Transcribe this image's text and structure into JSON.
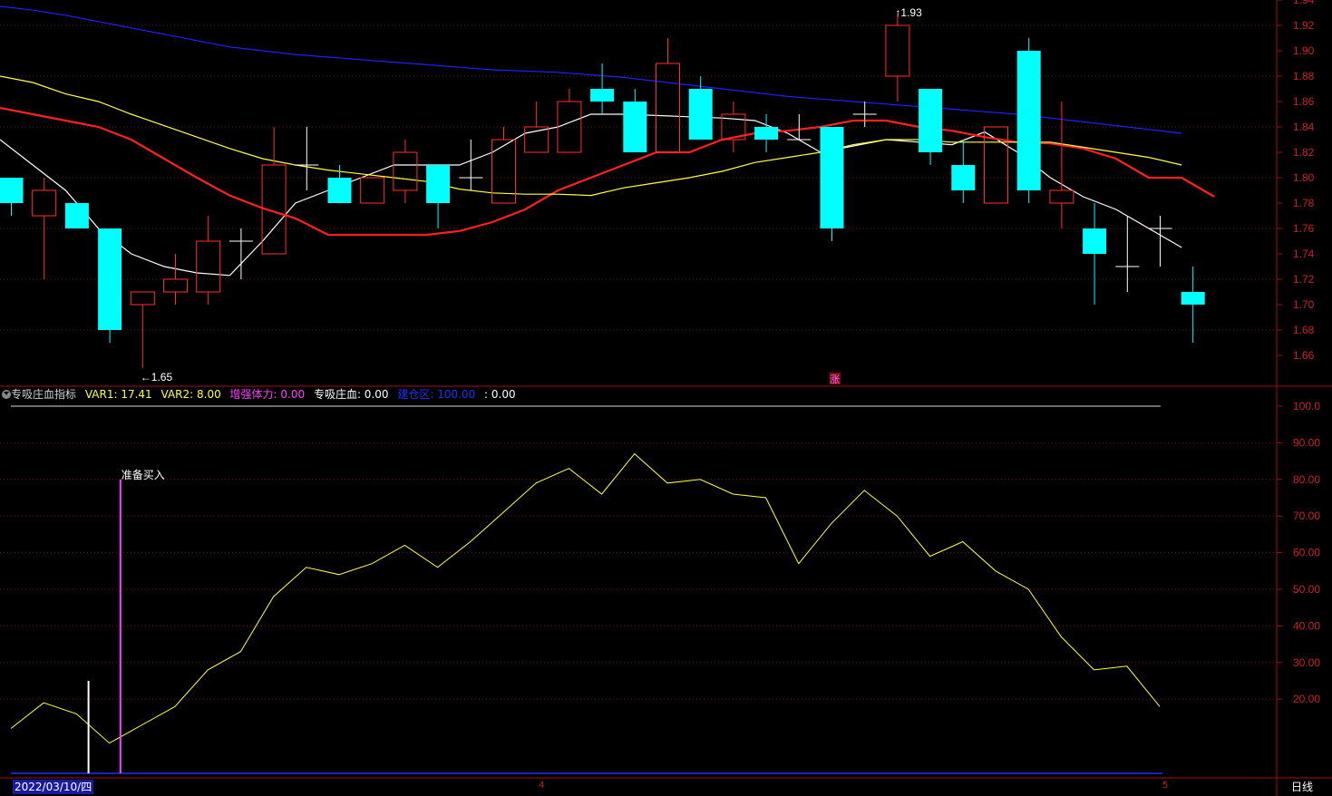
{
  "chart_data": [
    {
      "type": "candlestick",
      "panel": "main",
      "ylim": [
        1.64,
        1.94
      ],
      "y_ticks": [
        "1.94",
        "1.92",
        "1.90",
        "1.88",
        "1.86",
        "1.84",
        "1.82",
        "1.80",
        "1.78",
        "1.76",
        "1.74",
        "1.72",
        "1.70",
        "1.68",
        "1.66"
      ],
      "candles": [
        {
          "o": 1.8,
          "h": 1.8,
          "l": 1.77,
          "c": 1.78
        },
        {
          "o": 1.77,
          "h": 1.8,
          "l": 1.72,
          "c": 1.79
        },
        {
          "o": 1.78,
          "h": 1.78,
          "l": 1.76,
          "c": 1.76
        },
        {
          "o": 1.76,
          "h": 1.76,
          "l": 1.67,
          "c": 1.68
        },
        {
          "o": 1.7,
          "h": 1.71,
          "l": 1.65,
          "c": 1.71
        },
        {
          "o": 1.71,
          "h": 1.74,
          "l": 1.7,
          "c": 1.72
        },
        {
          "o": 1.71,
          "h": 1.77,
          "l": 1.7,
          "c": 1.75
        },
        {
          "o": 1.75,
          "h": 1.76,
          "l": 1.72,
          "c": 1.75
        },
        {
          "o": 1.74,
          "h": 1.84,
          "l": 1.74,
          "c": 1.81
        },
        {
          "o": 1.81,
          "h": 1.84,
          "l": 1.79,
          "c": 1.81
        },
        {
          "o": 1.8,
          "h": 1.81,
          "l": 1.78,
          "c": 1.78
        },
        {
          "o": 1.78,
          "h": 1.8,
          "l": 1.78,
          "c": 1.8
        },
        {
          "o": 1.79,
          "h": 1.83,
          "l": 1.78,
          "c": 1.82
        },
        {
          "o": 1.81,
          "h": 1.81,
          "l": 1.76,
          "c": 1.78
        },
        {
          "o": 1.8,
          "h": 1.83,
          "l": 1.79,
          "c": 1.8
        },
        {
          "o": 1.78,
          "h": 1.84,
          "l": 1.78,
          "c": 1.83
        },
        {
          "o": 1.82,
          "h": 1.86,
          "l": 1.82,
          "c": 1.84
        },
        {
          "o": 1.82,
          "h": 1.87,
          "l": 1.82,
          "c": 1.86
        },
        {
          "o": 1.87,
          "h": 1.89,
          "l": 1.85,
          "c": 1.86
        },
        {
          "o": 1.86,
          "h": 1.87,
          "l": 1.82,
          "c": 1.82
        },
        {
          "o": 1.82,
          "h": 1.91,
          "l": 1.82,
          "c": 1.89
        },
        {
          "o": 1.87,
          "h": 1.88,
          "l": 1.83,
          "c": 1.83
        },
        {
          "o": 1.83,
          "h": 1.86,
          "l": 1.82,
          "c": 1.85
        },
        {
          "o": 1.84,
          "h": 1.85,
          "l": 1.82,
          "c": 1.83
        },
        {
          "o": 1.83,
          "h": 1.85,
          "l": 1.83,
          "c": 1.83
        },
        {
          "o": 1.84,
          "h": 1.84,
          "l": 1.75,
          "c": 1.76
        },
        {
          "o": 1.85,
          "h": 1.86,
          "l": 1.84,
          "c": 1.85
        },
        {
          "o": 1.88,
          "h": 1.93,
          "l": 1.86,
          "c": 1.92
        },
        {
          "o": 1.87,
          "h": 1.87,
          "l": 1.81,
          "c": 1.82
        },
        {
          "o": 1.81,
          "h": 1.83,
          "l": 1.78,
          "c": 1.79
        },
        {
          "o": 1.78,
          "h": 1.84,
          "l": 1.78,
          "c": 1.84
        },
        {
          "o": 1.9,
          "h": 1.91,
          "l": 1.78,
          "c": 1.79
        },
        {
          "o": 1.78,
          "h": 1.86,
          "l": 1.76,
          "c": 1.79
        },
        {
          "o": 1.76,
          "h": 1.78,
          "l": 1.7,
          "c": 1.74
        },
        {
          "o": 1.73,
          "h": 1.77,
          "l": 1.71,
          "c": 1.73
        },
        {
          "o": 1.76,
          "h": 1.77,
          "l": 1.73,
          "c": 1.76
        },
        {
          "o": 1.71,
          "h": 1.73,
          "l": 1.67,
          "c": 1.7
        }
      ],
      "series": [
        {
          "color": "#ffffff",
          "values": [
            1.83,
            1.81,
            1.79,
            1.76,
            1.74,
            1.73,
            1.725,
            1.723,
            1.75,
            1.78,
            1.79,
            1.8,
            1.81,
            1.81,
            1.81,
            1.82,
            1.835,
            1.84,
            1.85,
            1.85,
            1.849,
            1.848,
            1.847,
            1.845,
            1.835,
            1.82,
            1.825,
            1.83,
            1.828,
            1.826,
            1.836,
            1.82,
            1.8,
            1.785,
            1.775,
            1.76,
            1.745
          ]
        },
        {
          "color": "#ff2020",
          "values": [
            1.855,
            1.85,
            1.845,
            1.84,
            1.83,
            1.815,
            1.8,
            1.786,
            1.776,
            1.768,
            1.755,
            1.755,
            1.755,
            1.755,
            1.758,
            1.765,
            1.775,
            1.79,
            1.8,
            1.81,
            1.82,
            1.82,
            1.83,
            1.835,
            1.837,
            1.84,
            1.845,
            1.845,
            1.84,
            1.837,
            1.832,
            1.828,
            1.827,
            1.823,
            1.815,
            1.8,
            1.8,
            1.785
          ]
        },
        {
          "color": "#ffff40",
          "values": [
            1.88,
            1.875,
            1.866,
            1.86,
            1.85,
            1.841,
            1.832,
            1.823,
            1.815,
            1.81,
            1.806,
            1.803,
            1.8,
            1.797,
            1.791,
            1.788,
            1.787,
            1.787,
            1.786,
            1.792,
            1.796,
            1.8,
            1.805,
            1.812,
            1.816,
            1.82,
            1.826,
            1.83,
            1.83,
            1.828,
            1.828,
            1.828,
            1.828,
            1.824,
            1.82,
            1.816,
            1.81
          ]
        },
        {
          "color": "#2020ff",
          "values": [
            1.935,
            1.932,
            1.928,
            1.923,
            1.918,
            1.913,
            1.908,
            1.903,
            1.9,
            1.897,
            1.895,
            1.893,
            1.891,
            1.889,
            1.887,
            1.885,
            1.884,
            1.883,
            1.881,
            1.879,
            1.876,
            1.873,
            1.87,
            1.867,
            1.864,
            1.862,
            1.86,
            1.858,
            1.856,
            1.854,
            1.852,
            1.85,
            1.847,
            1.844,
            1.841,
            1.838,
            1.835
          ]
        }
      ],
      "annotations": [
        {
          "candle": 4,
          "value": 1.65,
          "text": "←1.65"
        },
        {
          "candle": 27,
          "value": 1.93,
          "text": "↑1.93"
        },
        {
          "candle": 25,
          "text": "涨"
        }
      ]
    },
    {
      "type": "line",
      "panel": "indicator",
      "title": "专吸庄血指标",
      "ylim": [
        0,
        100
      ],
      "y_ticks": [
        "100.0",
        "90.00",
        "80.00",
        "70.00",
        "60.00",
        "50.00",
        "40.00",
        "30.00",
        "20.00"
      ],
      "series": [
        {
          "color": "#ffff40",
          "values": [
            12,
            19,
            16,
            8,
            13,
            18,
            28,
            33,
            48,
            56,
            54,
            57,
            62,
            56,
            63,
            71,
            79,
            83,
            76,
            87,
            79,
            80,
            76,
            75,
            57,
            68,
            77,
            70,
            59,
            63,
            55,
            50,
            37,
            28,
            29,
            18
          ]
        }
      ],
      "reference_line": 100,
      "signals": [
        {
          "candle": 3,
          "value": 25,
          "color": "#ffffff"
        },
        {
          "candle": 4,
          "value": 80,
          "color": "#ff40ff",
          "label": "准备买入"
        }
      ]
    }
  ],
  "indicator_bar": {
    "name": "专吸庄血指标",
    "var1": "VAR1: 17.41",
    "var2": "VAR2: 8.00",
    "zengqiang": "增强体力: 0.00",
    "zhuanxi": "专吸庄血: 0.00",
    "jianduqu": "建仓区: 100.00",
    "tail": ": 0.00"
  },
  "x_axis": {
    "date": "2022/03/10/四",
    "month_4": "4",
    "month_5": "5"
  },
  "period": "日线",
  "colors": {
    "up": "#ff3030",
    "down": "#00ffff",
    "grid": "#7a1010",
    "axis": "#a01010"
  }
}
